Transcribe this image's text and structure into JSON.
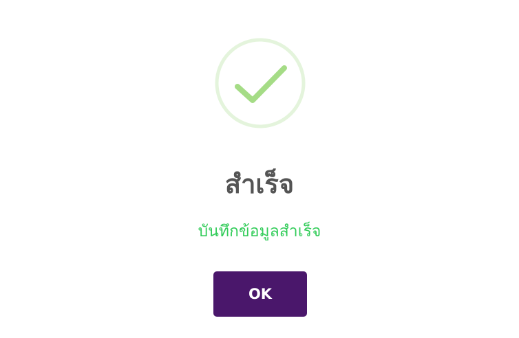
{
  "dialog": {
    "icon": "success-check-icon",
    "title": "สำเร็จ",
    "message": "บันทึกข้อมูลสำเร็จ",
    "ok_label": "OK"
  },
  "colors": {
    "icon_ring": "#e4f4dc",
    "icon_check": "#a5dc86",
    "title": "#545454",
    "message": "#33cc5a",
    "button_bg": "#4a176b",
    "button_text": "#ffffff"
  }
}
